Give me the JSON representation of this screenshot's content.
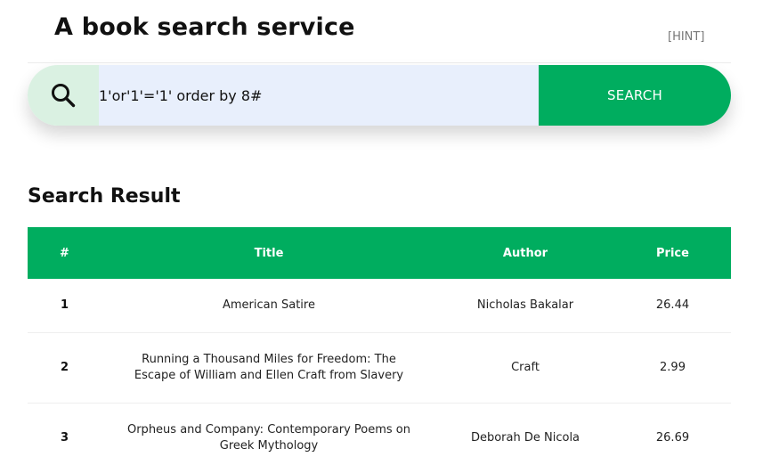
{
  "header": {
    "title": "A book search service",
    "hint_label": "[HINT]"
  },
  "search": {
    "icon": "magnifier-icon",
    "query": "1'or'1'='1' order by 8#",
    "button_label": "SEARCH"
  },
  "results": {
    "heading": "Search Result",
    "columns": [
      "#",
      "Title",
      "Author",
      "Price"
    ],
    "rows": [
      {
        "num": "1",
        "title": "American Satire",
        "author": "Nicholas Bakalar",
        "price": "26.44"
      },
      {
        "num": "2",
        "title": "Running a Thousand Miles for Freedom: The Escape of William and Ellen Craft from Slavery",
        "author": "Craft",
        "price": "2.99"
      },
      {
        "num": "3",
        "title": "Orpheus and Company: Contemporary Poems on Greek Mythology",
        "author": "Deborah De Nicola",
        "price": "26.69"
      }
    ]
  },
  "colors": {
    "accent": "#00ad5f",
    "icon_bg": "#daf1e2",
    "input_bg": "#e8effc"
  }
}
